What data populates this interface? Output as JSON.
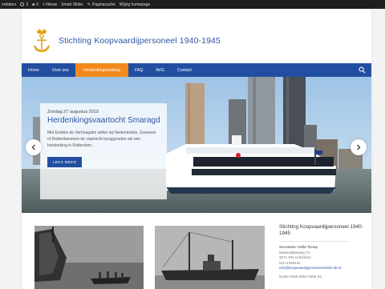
{
  "admin_bar": {
    "items": [
      "ordaters",
      "3",
      "0",
      "+ Nieuw",
      "Smart Slider",
      "Paginacache",
      "Wijzig homepage"
    ]
  },
  "site": {
    "title": "Stichting Koopvaardijpersoneel 1940-1945"
  },
  "nav": {
    "items": [
      "Home",
      "Over ons",
      "Herdenkingsmiddag",
      "FAQ",
      "AVG",
      "Contact"
    ],
    "active_index": 2
  },
  "hero": {
    "date": "Zondag 27 augustus 2019",
    "title": "Herdenkingsvaartocht Smaragd",
    "text": "Met Eveline de Verheugden willen wij Nederlandse, Zeeuwse of Rotterdammers de vaartocht teruggroeten als een herdenking in Rotterdam.",
    "button_label": "LEES MEER"
  },
  "sidebar": {
    "title": "Stichting Koopvaardijpersoneel 1940-1945",
    "secretary": "Secretaris: Hella Tromp",
    "address_1": "Maasvlakteweg 74",
    "address_2": "3071 RN Schiedam",
    "phone": "010 4269151",
    "email": "info@koopvaardijpersoneel1940-45.nl",
    "bank": "NL86 INGB 0002 9356 54"
  },
  "colors": {
    "brand_blue": "#224ea1",
    "accent_orange": "#f28a1e",
    "title_blue": "#2d56a3"
  }
}
